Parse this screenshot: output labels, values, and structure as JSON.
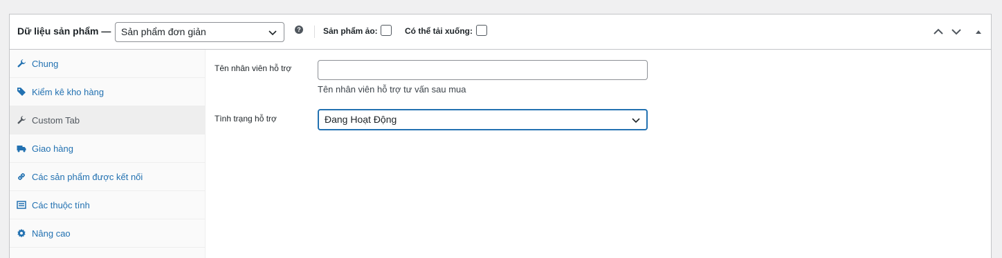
{
  "header": {
    "title": "Dữ liệu sản phẩm —",
    "product_type": "Sản phẩm đơn giản",
    "help_icon": "question-mark",
    "virtual_label": "Sản phẩm ảo:",
    "virtual_checked": false,
    "downloadable_label": "Có thể tải xuống:",
    "downloadable_checked": false
  },
  "sidebar": {
    "items": [
      {
        "label": "Chung",
        "icon": "wrench-icon",
        "active": false
      },
      {
        "label": "Kiểm kê kho hàng",
        "icon": "tag-icon",
        "active": false
      },
      {
        "label": "Custom Tab",
        "icon": "wrench-icon",
        "active": true
      },
      {
        "label": "Giao hàng",
        "icon": "truck-icon",
        "active": false
      },
      {
        "label": "Các sản phẩm được kết nối",
        "icon": "link-icon",
        "active": false
      },
      {
        "label": "Các thuộc tính",
        "icon": "list-icon",
        "active": false
      },
      {
        "label": "Nâng cao",
        "icon": "gear-icon",
        "active": false
      }
    ]
  },
  "main": {
    "support_name_label": "Tên nhân viên hỗ trợ",
    "support_name_value": "",
    "support_name_desc": "Tên nhân viên hỗ trợ tư vấn sau mua",
    "support_status_label": "Tình trạng hỗ trợ",
    "support_status_value": "Đang Hoạt Động"
  },
  "colors": {
    "link": "#2271b1",
    "active_tab_bg": "#eeeeee",
    "focus_border": "#2271b1"
  }
}
